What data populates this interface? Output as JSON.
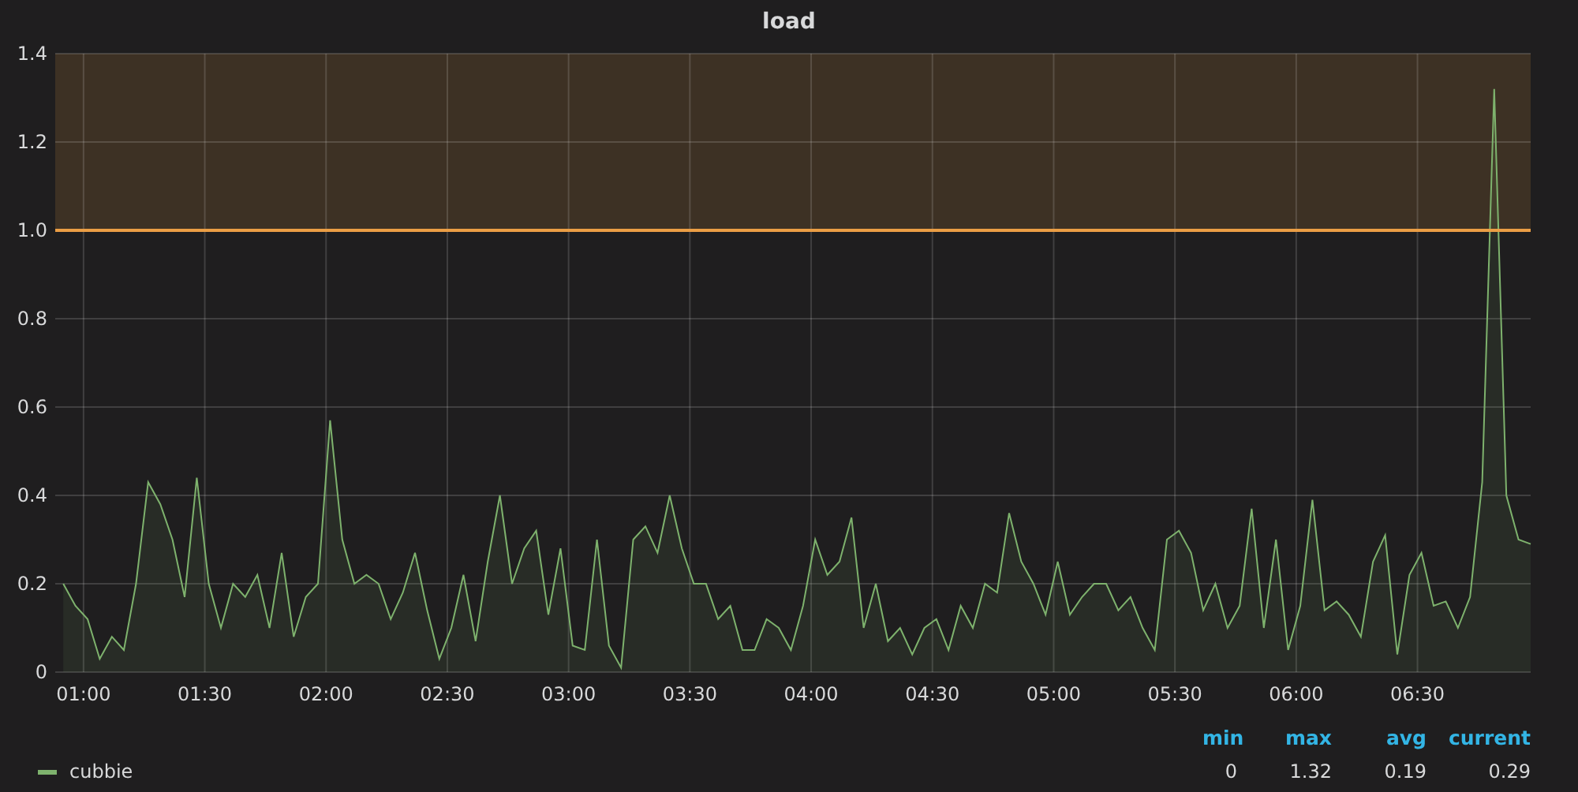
{
  "panel": {
    "title": "load",
    "chart_data": {
      "type": "area",
      "grid": true,
      "xlim": [
        53,
        418
      ],
      "ylim": [
        0,
        1.4
      ],
      "yticks": [
        {
          "value": 0,
          "label": "0"
        },
        {
          "value": 0.2,
          "label": "0.2"
        },
        {
          "value": 0.4,
          "label": "0.4"
        },
        {
          "value": 0.6,
          "label": "0.6"
        },
        {
          "value": 0.8,
          "label": "0.8"
        },
        {
          "value": 1.0,
          "label": "1.0"
        },
        {
          "value": 1.2,
          "label": "1.2"
        },
        {
          "value": 1.4,
          "label": "1.4"
        }
      ],
      "xticks": [
        {
          "value": 60,
          "label": "01:00"
        },
        {
          "value": 90,
          "label": "01:30"
        },
        {
          "value": 120,
          "label": "02:00"
        },
        {
          "value": 150,
          "label": "02:30"
        },
        {
          "value": 180,
          "label": "03:00"
        },
        {
          "value": 210,
          "label": "03:30"
        },
        {
          "value": 240,
          "label": "04:00"
        },
        {
          "value": 270,
          "label": "04:30"
        },
        {
          "value": 300,
          "label": "05:00"
        },
        {
          "value": 330,
          "label": "05:30"
        },
        {
          "value": 360,
          "label": "06:00"
        },
        {
          "value": 390,
          "label": "06:30"
        }
      ],
      "x": [
        55,
        58,
        61,
        64,
        67,
        70,
        73,
        76,
        79,
        82,
        85,
        88,
        91,
        94,
        97,
        100,
        103,
        106,
        109,
        112,
        115,
        118,
        121,
        124,
        127,
        130,
        133,
        136,
        139,
        142,
        145,
        148,
        151,
        154,
        157,
        160,
        163,
        166,
        169,
        172,
        175,
        178,
        181,
        184,
        187,
        190,
        193,
        196,
        199,
        202,
        205,
        208,
        211,
        214,
        217,
        220,
        223,
        226,
        229,
        232,
        235,
        238,
        241,
        244,
        247,
        250,
        253,
        256,
        259,
        262,
        265,
        268,
        271,
        274,
        277,
        280,
        283,
        286,
        289,
        292,
        295,
        298,
        301,
        304,
        307,
        310,
        313,
        316,
        319,
        322,
        325,
        328,
        331,
        334,
        337,
        340,
        343,
        346,
        349,
        352,
        355,
        358,
        361,
        364,
        367,
        370,
        373,
        376,
        379,
        382,
        385,
        388,
        391,
        394,
        397,
        400,
        403,
        406,
        409,
        412,
        415,
        418
      ],
      "series": [
        {
          "name": "cubbie",
          "color": "#7eb26d",
          "values": [
            0.2,
            0.15,
            0.12,
            0.03,
            0.08,
            0.05,
            0.2,
            0.43,
            0.38,
            0.3,
            0.17,
            0.44,
            0.2,
            0.1,
            0.2,
            0.17,
            0.22,
            0.1,
            0.27,
            0.08,
            0.17,
            0.2,
            0.57,
            0.3,
            0.2,
            0.22,
            0.2,
            0.12,
            0.18,
            0.27,
            0.14,
            0.03,
            0.1,
            0.22,
            0.07,
            0.25,
            0.4,
            0.2,
            0.28,
            0.32,
            0.13,
            0.28,
            0.06,
            0.05,
            0.3,
            0.06,
            0.01,
            0.3,
            0.33,
            0.27,
            0.4,
            0.28,
            0.2,
            0.2,
            0.12,
            0.15,
            0.05,
            0.05,
            0.12,
            0.1,
            0.05,
            0.15,
            0.3,
            0.22,
            0.25,
            0.35,
            0.1,
            0.2,
            0.07,
            0.1,
            0.04,
            0.1,
            0.12,
            0.05,
            0.15,
            0.1,
            0.2,
            0.18,
            0.36,
            0.25,
            0.2,
            0.13,
            0.25,
            0.13,
            0.17,
            0.2,
            0.2,
            0.14,
            0.17,
            0.1,
            0.05,
            0.3,
            0.32,
            0.27,
            0.14,
            0.2,
            0.1,
            0.15,
            0.37,
            0.1,
            0.3,
            0.05,
            0.15,
            0.39,
            0.14,
            0.16,
            0.13,
            0.08,
            0.25,
            0.31,
            0.04,
            0.22,
            0.27,
            0.15,
            0.16,
            0.1,
            0.17,
            0.43,
            1.32,
            0.4,
            0.3,
            0.29
          ]
        }
      ],
      "ref_lines": [
        {
          "axis": "y",
          "value": 1.0,
          "color": "#eb9e45"
        }
      ],
      "bands": [
        {
          "axis": "y",
          "from": 1.0,
          "to": 1.4,
          "color": "#eb9e45"
        }
      ]
    },
    "legend": {
      "columns": [
        "min",
        "max",
        "avg",
        "current"
      ],
      "series": [
        {
          "values": [
            "0",
            "1.32",
            "0.19",
            "0.29"
          ]
        }
      ]
    }
  }
}
